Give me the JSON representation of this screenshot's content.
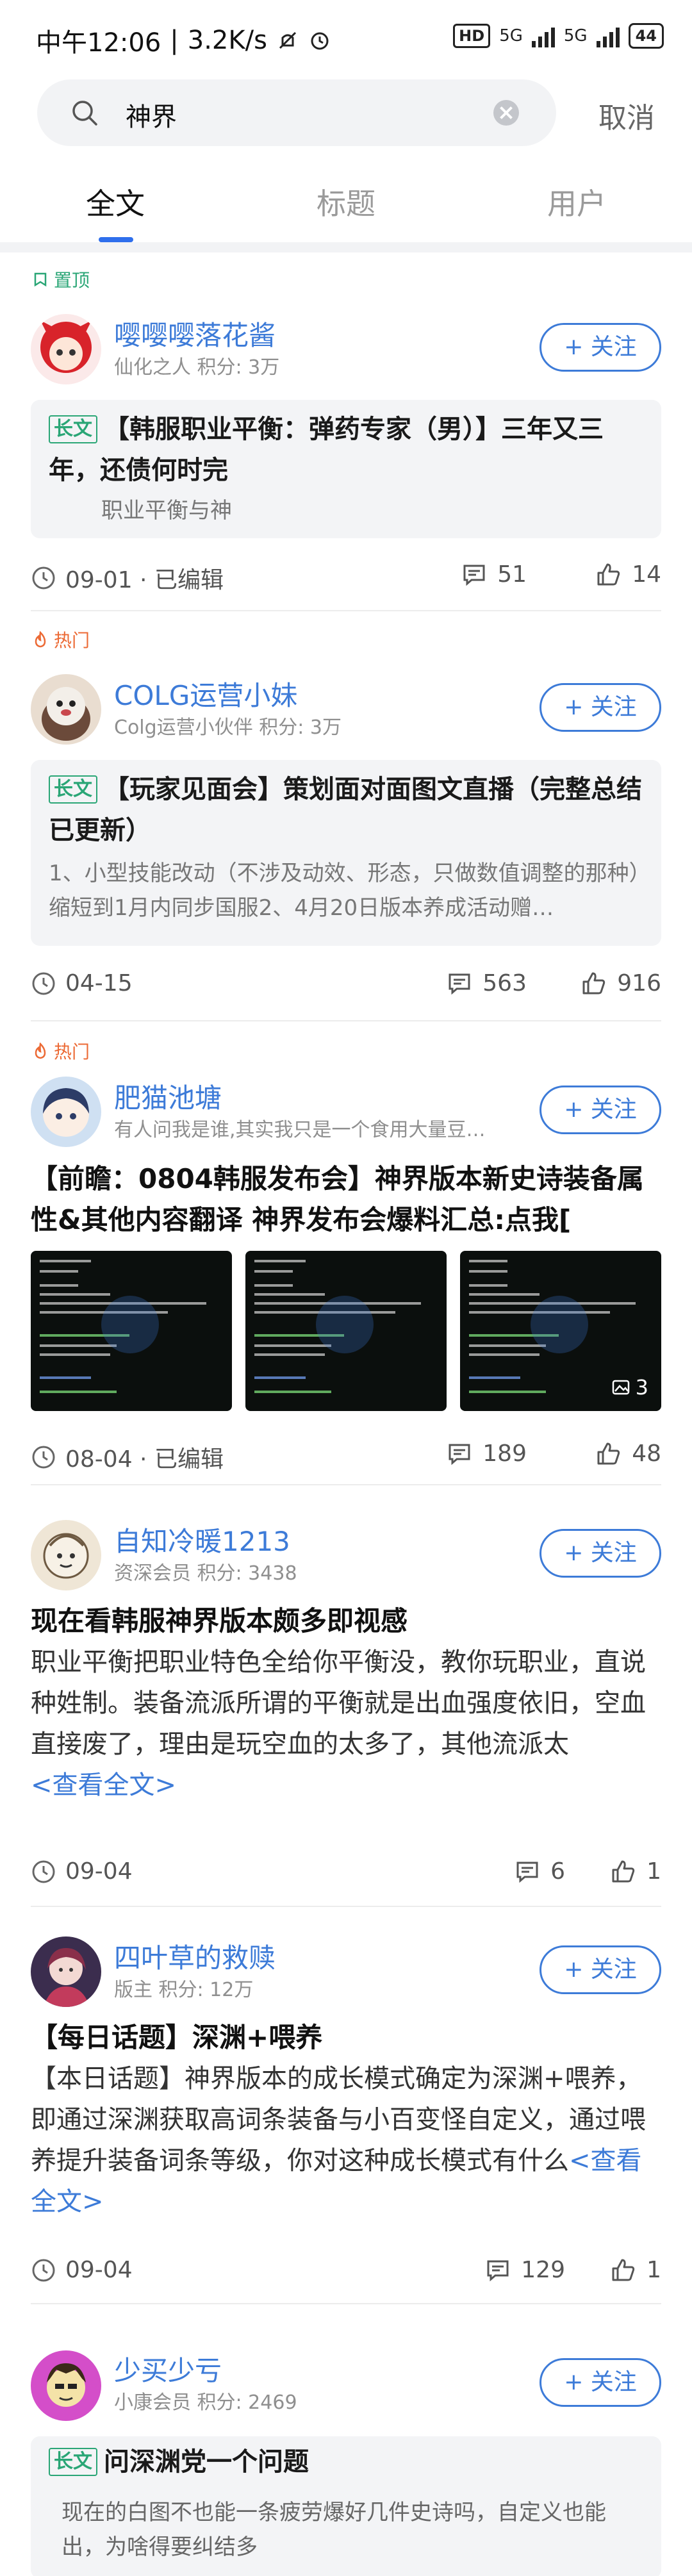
{
  "status_bar": {
    "time": "中午12:06",
    "speed": "3.2K/s",
    "hd_label": "HD",
    "network1": "5G",
    "network2": "5G",
    "battery": "44"
  },
  "search": {
    "query": "神界",
    "cancel_label": "取消"
  },
  "tabs": [
    {
      "label": "全文",
      "active": true
    },
    {
      "label": "标题",
      "active": false
    },
    {
      "label": "用户",
      "active": false
    }
  ],
  "posts": [
    {
      "badge": "置顶",
      "username": "嘤嘤嘤落花酱",
      "user_meta": "仙化之人  积分: 3万",
      "follow_label": "+ 关注",
      "tag": "长文",
      "title": "【韩服职业平衡：弹药专家（男）】三年又三年，还债何时完",
      "subtitle": "职业平衡与神",
      "date": "09-01 · 已编辑",
      "comments": "51",
      "likes": "14"
    },
    {
      "badge": "热门",
      "username": "COLG运营小妹",
      "user_meta": "Colg运营小伙伴  积分: 3万",
      "follow_label": "+ 关注",
      "tag": "长文",
      "title": "【玩家见面会】策划面对面图文直播（完整总结已更新）",
      "subtitle": "1、小型技能改动（不涉及动效、形态，只做数值调整的那种）缩短到1月内同步国服2、4月20日版本养成活动赠…",
      "date": "04-15",
      "comments": "563",
      "likes": "916"
    },
    {
      "badge": "热门",
      "username": "肥猫池塘",
      "user_meta": "有人问我是谁,其实我只是一个食用大量豆…",
      "follow_label": "+ 关注",
      "title": "【前瞻：0804韩服发布会】神界版本新史诗装备属性&其他内容翻译     神界发布会爆料汇总:点我[",
      "image_count": "3",
      "date": "08-04 · 已编辑",
      "comments": "189",
      "likes": "48"
    },
    {
      "username": "自知冷暖1213",
      "user_meta": "资深会员  积分: 3438",
      "follow_label": "+ 关注",
      "title": "现在看韩服神界版本颇多即视感",
      "body": "职业平衡把职业特色全给你平衡没，教你玩职业，直说种姓制。装备流派所谓的平衡就是出血强度依旧，空血直接废了，理由是玩空血的太多了，其他流派太",
      "read_more": "<查看全文>",
      "date": "09-04",
      "comments": "6",
      "likes": "1"
    },
    {
      "username": "四叶草的救赎",
      "user_meta": "版主  积分: 12万",
      "follow_label": "+ 关注",
      "title": "【每日话题】深渊+喂养",
      "body": "【本日话题】神界版本的成长模式确定为深渊+喂养，即通过深渊获取高词条装备与小百变怪自定义，通过喂养提升装备词条等级，你对这种成长模式有什么",
      "read_more": "<查看全文>",
      "date": "09-04",
      "comments": "129",
      "likes": "1"
    },
    {
      "username": "少买少亏",
      "user_meta": "小康会员  积分: 2469",
      "follow_label": "+ 关注",
      "tag": "长文",
      "title": "问深渊党一个问题",
      "subtitle": "现在的白图不也能一条疲劳爆好几件史诗吗，自定义也能出，为啥得要纠结多"
    }
  ],
  "colors": {
    "accent_blue": "#3d7bd8",
    "tab_indicator": "#2f6fec",
    "pin_green": "#2aa676",
    "hot_orange": "#ec6a35"
  }
}
